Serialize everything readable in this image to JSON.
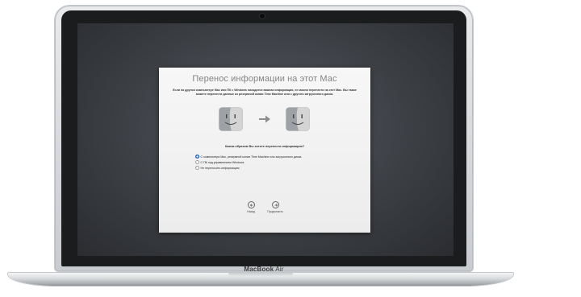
{
  "device": {
    "brand_bold": "MacBook",
    "brand_rest": " Air"
  },
  "dialog": {
    "title": "Перенос информации на этот Мас",
    "description": "Если на другом компьютере Mac или ПК с Windows находится важная информация, ее можно перенести на этот Mac. Вы также можете перенести данные из резервной копии Time Machine или с другого загрузочного диска.",
    "question": "Каким образом Вы хотите перенести информацию?",
    "options": [
      {
        "label": "С компьютера Mac, резервной копии Time Machine или загрузочного диска",
        "selected": true
      },
      {
        "label": "С ПК под управлением Windows",
        "selected": false
      },
      {
        "label": "Не переносить информацию",
        "selected": false
      }
    ],
    "back_label": "Назад",
    "continue_label": "Продолжить",
    "icons": [
      "finder-icon",
      "right-arrow-icon",
      "finder-icon"
    ]
  },
  "colors": {
    "accent": "#2f7fe0"
  }
}
